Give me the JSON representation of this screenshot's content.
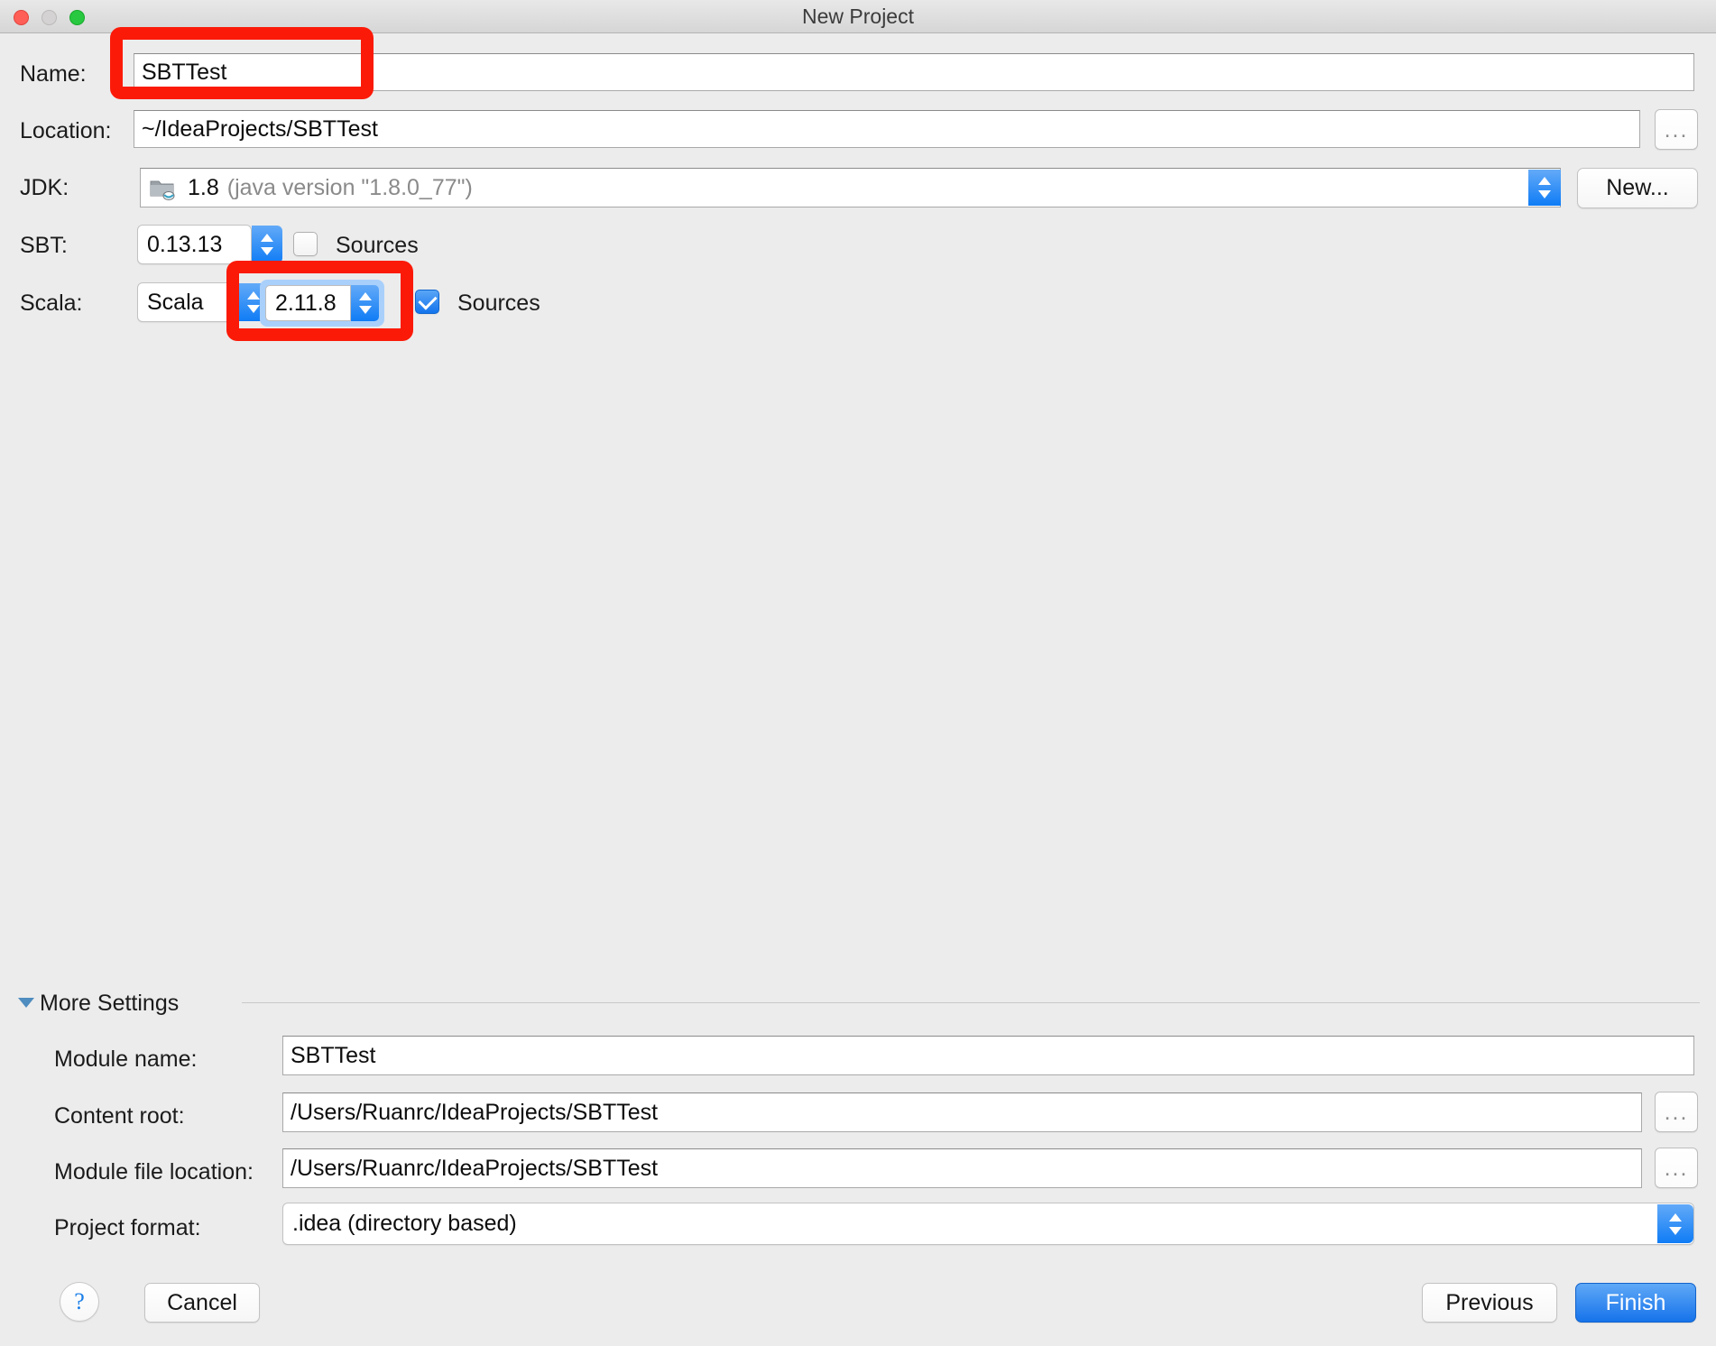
{
  "window": {
    "title": "New Project",
    "traffic_lights": [
      "close-red",
      "minimize-disabled",
      "zoom-green"
    ]
  },
  "form": {
    "name": {
      "label": "Name:",
      "value": "SBTTest"
    },
    "location": {
      "label": "Location:",
      "value": "~/IdeaProjects/SBTTest",
      "browse_label": "..."
    },
    "jdk": {
      "label": "JDK:",
      "value": "1.8",
      "value_detail": "(java version \"1.8.0_77\")",
      "new_button": "New..."
    },
    "sbt": {
      "label": "SBT:",
      "version": "0.13.13",
      "sources_label": "Sources",
      "sources_checked": false
    },
    "scala": {
      "label": "Scala:",
      "kind": "Scala",
      "version": "2.11.8",
      "sources_label": "Sources",
      "sources_checked": true
    }
  },
  "more_settings": {
    "label": "More Settings",
    "expanded": true,
    "fields": [
      {
        "label": "Module name:",
        "value": "SBTTest",
        "browse": false
      },
      {
        "label": "Content root:",
        "value": "/Users/Ruanrc/IdeaProjects/SBTTest",
        "browse": true
      },
      {
        "label": "Module file location:",
        "value": "/Users/Ruanrc/IdeaProjects/SBTTest",
        "browse": true
      }
    ],
    "project_format": {
      "label": "Project format:",
      "value": ".idea (directory based)"
    },
    "browse_label": "..."
  },
  "footer": {
    "help_label": "?",
    "cancel_label": "Cancel",
    "previous_label": "Previous",
    "finish_label": "Finish"
  },
  "annotations": {
    "accent_color": "#fb1a08",
    "highlights": [
      "name-field",
      "scala-version-stepper"
    ]
  }
}
